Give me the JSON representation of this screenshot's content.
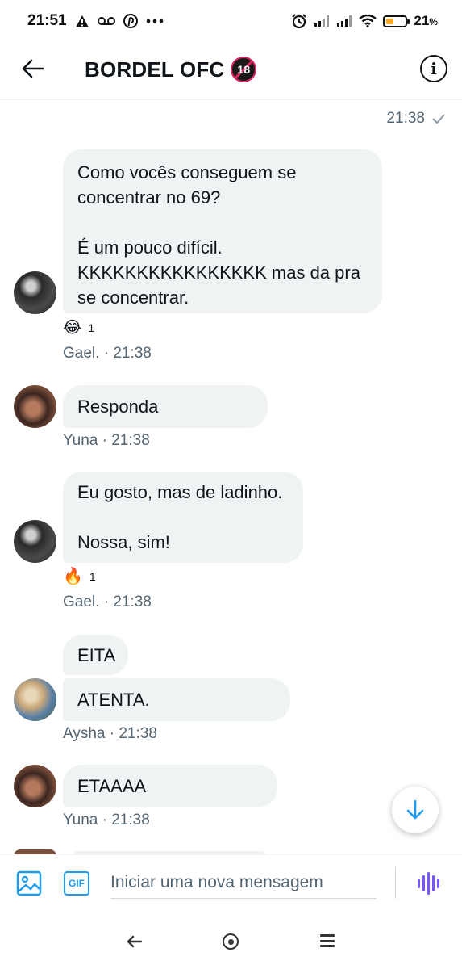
{
  "status_bar": {
    "time": "21:51",
    "battery_percent": "21",
    "battery_unit": "%",
    "battery_level": 0.21,
    "left_icons": [
      "warning-icon",
      "voicemail-icon",
      "pinterest-icon",
      "more-dots-icon"
    ],
    "right_icons": [
      "alarm-icon",
      "signal-icon",
      "signal-icon",
      "wifi-icon",
      "battery-icon"
    ]
  },
  "header": {
    "title": "BORDEL OFC",
    "badge": "18",
    "back_icon": "arrow-left-icon",
    "info_icon": "info-icon"
  },
  "top_timestamp": "21:38",
  "messages": [
    {
      "author": "Gael.",
      "time": "21:38",
      "bubbles": [
        "Como vocês conseguem se\nconcentrar no 69?\n\nÉ um pouco difícil.\nKKKKKKKKKKKKKKKK mas da pra\nse concentrar."
      ],
      "reaction": {
        "emoji": "😂",
        "count": "1"
      }
    },
    {
      "author": "Yuna",
      "time": "21:38",
      "bubbles": [
        "Responda"
      ]
    },
    {
      "author": "Gael.",
      "time": "21:38",
      "bubbles": [
        "Eu gosto, mas de ladinho.\n\nNossa, sim!"
      ],
      "reaction": {
        "emoji": "🔥",
        "count": "1"
      }
    },
    {
      "author": "Aysha",
      "time": "21:38",
      "bubbles": [
        "EITA",
        "ATENTA."
      ]
    },
    {
      "author": "Yuna",
      "time": "21:38",
      "bubbles": [
        "ETAAAA"
      ]
    }
  ],
  "composer": {
    "placeholder": "Iniciar uma nova mensagem",
    "gif_label": "GIF",
    "accent": "#1d9bf0",
    "voice_color": "#7856ff"
  },
  "nav_bar": {
    "back_icon": "nav-back-icon",
    "home_icon": "nav-home-icon",
    "menu_icon": "nav-menu-icon"
  }
}
